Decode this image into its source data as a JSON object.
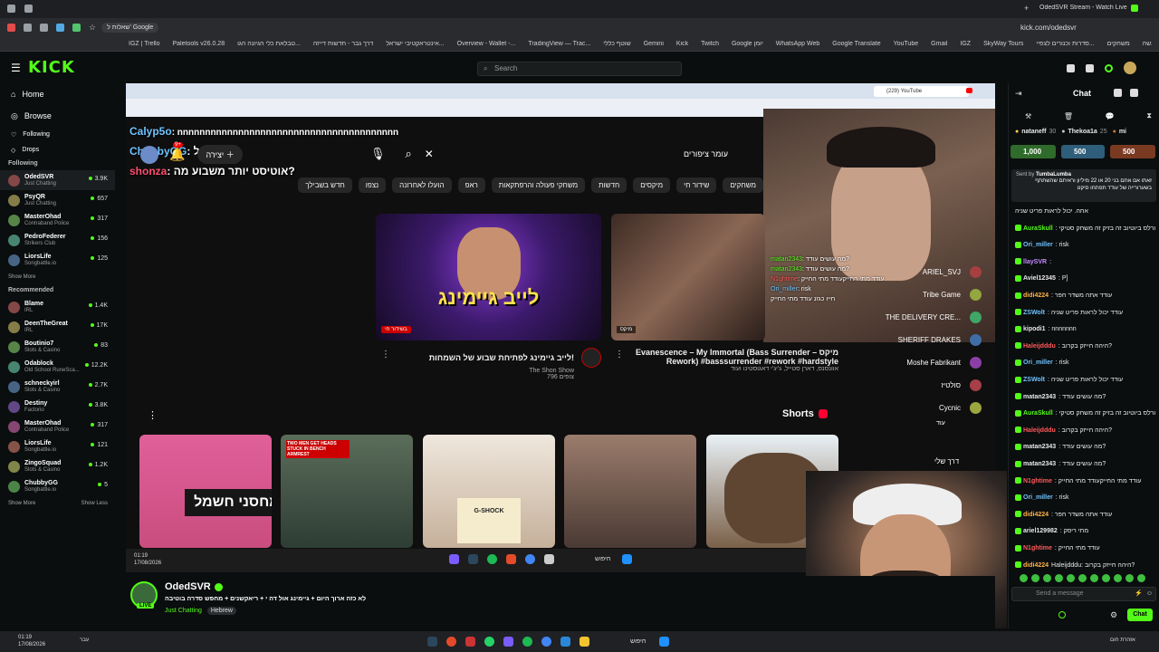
{
  "browser": {
    "tabs": [
      {
        "label": "שאלות ל' Google"
      },
      {
        "label": "OdedSVR Stream - Watch Live"
      }
    ],
    "address": "kick.com/odedsvr",
    "bookmarks": [
      "IGZ | Trello",
      "Paletools v26.0.28",
      "טבלאת כלי הגיונה הגו...",
      "דרך גבר - חדשות דייזה",
      "אינטראקטיבי ישראל...",
      "Overview - Wallet -...",
      "TradingView — Trac...",
      "שוטף כללי",
      "Gemini",
      "Kick",
      "Twitch",
      "Google יומן",
      "WhatsApp Web",
      "Google Translate",
      "YouTube",
      "Gmail",
      "IGZ",
      "SkyWay Tours",
      "סדרות וכנורים לצפיי...",
      "משחקים",
      "למעשה"
    ]
  },
  "kick": {
    "logo": "KICK",
    "search_placeholder": "Search",
    "brand_color": "#53fc18"
  },
  "sidebar": {
    "nav": [
      {
        "label": "Home",
        "icon": "home-icon"
      },
      {
        "label": "Browse",
        "icon": "compass-icon"
      },
      {
        "label": "Following",
        "icon": "heart-icon"
      },
      {
        "label": "Drops",
        "icon": "drop-icon"
      }
    ],
    "following_title": "Following",
    "following": [
      {
        "name": "OdedSVR",
        "category": "Just Chatting",
        "viewers": "3.9K"
      },
      {
        "name": "PsyQR",
        "category": "Just Chatting",
        "viewers": "657"
      },
      {
        "name": "MasterOhad",
        "category": "Contraband Police",
        "viewers": "317"
      },
      {
        "name": "PedroFederer",
        "category": "Strikers Club",
        "viewers": "156"
      },
      {
        "name": "LiorsLife",
        "category": "Songbattle.io",
        "viewers": "125"
      }
    ],
    "show_more": "Show More",
    "recommended_title": "Recommended",
    "recommended": [
      {
        "name": "Blame",
        "category": "IRL",
        "viewers": "1.4K"
      },
      {
        "name": "DeenTheGreat",
        "category": "IRL",
        "viewers": "17K"
      },
      {
        "name": "Boutinio7",
        "category": "Slots & Casino",
        "viewers": "83"
      },
      {
        "name": "Odablock",
        "category": "Old School RuneSca...",
        "viewers": "12.2K"
      },
      {
        "name": "schneckyirl",
        "category": "Slots & Casino",
        "viewers": "2.7K"
      },
      {
        "name": "Destiny",
        "category": "Factorio",
        "viewers": "3.8K"
      },
      {
        "name": "MasterOhad",
        "category": "Contraband Police",
        "viewers": "317"
      },
      {
        "name": "LiorsLife",
        "category": "Songbattle.io",
        "viewers": "121"
      },
      {
        "name": "ZingoSquad",
        "category": "Slots & Casino",
        "viewers": "1.2K"
      },
      {
        "name": "ChubbyGG",
        "category": "Songbattle.io",
        "viewers": "5"
      }
    ],
    "show_more_2": "Show More",
    "show_less": "Show Less"
  },
  "overlay_big": [
    {
      "user": "Calyp5o",
      "text": ": nnnnnnnnnnnnnnnnnnnnnnnnnnnnnnnnnnnnnnnn"
    },
    {
      "user": "ChubbyGG",
      "text": ": פאמל?"
    },
    {
      "user": "shonza",
      "text": ": אוטיסט יותר משבוע מה?"
    }
  ],
  "youtube": {
    "inner_tab": "(229) YouTube",
    "search_value": "עומר ציפורים",
    "create_label": "יצירה",
    "notif_count": "9+",
    "chips": [
      "משחקים",
      "שידור חי",
      "מיקסים",
      "חדשות",
      "משחקי פעולה והרפתקאות",
      "ראפ",
      "הועלו לאחרונה",
      "נצפו",
      "חדש בשבילך"
    ],
    "video1": {
      "thumb_text": "לייב גיימינג",
      "title": "לייב גיימינג לפתיחת שבוע של השמחות!",
      "channel": "The Shon Show",
      "meta": "796 צופים",
      "badge": "בשידור חי"
    },
    "video2": {
      "title": "Evanescence – My Immortal (Bass Surrender – מיקס Rework) #basssurrender #rework #hardstyle",
      "meta": "אוונסנס, דארן סטייל, ג'יג'י דאגוסטינו ועוד",
      "badge": "מיקס"
    },
    "shorts_title": "Shorts",
    "shorts": [
      "מחסני חשמל",
      "TWO MEN GET HEADS STUCK IN BENCH ARMREST",
      "G-SHOCK",
      "",
      ""
    ],
    "sidebar_channels": [
      "ARIEL_SVJ",
      "Tribe Game",
      "THE DELIVERY CRE...",
      "SHERIFF DRAKES",
      "Moshe Fabrikant",
      "סולטיז",
      "Cycnic"
    ],
    "sidebar_more": "עוד",
    "sidebar_browse": "דרך שלי",
    "taskbar_time": "01:19",
    "taskbar_date": "17/08/2026",
    "taskbar_search": "חיפוש"
  },
  "stream_overlay_chat": [
    {
      "user": "matan2343",
      "text": ": מה עושים עודד?"
    },
    {
      "user": "matan2343",
      "text": ": מה עושים עודד?"
    },
    {
      "user": "N1ghtime",
      "text": ": עודד מתי החייקעודד מתי החייק"
    },
    {
      "user": "Ori_miller",
      "text": ": risk"
    },
    {
      "user": "",
      "text": "חייו כגזנ עודד מתי החייק"
    }
  ],
  "stream_info": {
    "name": "OdedSVR",
    "title": "לא כזה ארוך היום + גיימינג אול דה י + ריאקשנים + מחפש סדרה בוטיבה",
    "category": "Just Chatting",
    "tag": "Hebrew"
  },
  "chat": {
    "title": "Chat",
    "top_gifters": [
      {
        "name": "nataneff",
        "count": "30"
      },
      {
        "name": "Thekoa1a",
        "count": "25"
      },
      {
        "name": "mi",
        "count": ""
      }
    ],
    "gifts": [
      {
        "amount": "1,000",
        "color": "#2f6b2a"
      },
      {
        "amount": "500",
        "color": "#2f5e7a"
      },
      {
        "amount": "500",
        "color": "#7a3a22"
      }
    ],
    "pinned_sender": "Sent by",
    "pinned_user": "TumbaLumba",
    "pinned_text": "זאתו אם אתם בני 20 או 22 מיליון וראיתם שהשתתף בשערורייה של עודד תפתחו סיקט",
    "messages": [
      {
        "user": "",
        "text": "אחה. יכול לראות פריט שניה",
        "color": "#e8e8e8"
      },
      {
        "user": "AuraSkull",
        "text": ": עודד תכתוב בגורלס ביוטיוב זה בזיק זה משחק סטיקי",
        "color": "#53fc18"
      },
      {
        "user": "Ori_miller",
        "text": ": risk",
        "color": "#6fc3ff"
      },
      {
        "user": "llaySVR",
        "text": ":",
        "color": "#c38bff"
      },
      {
        "user": "Aviel12345",
        "text": ": P]",
        "color": "#e8e8e8"
      },
      {
        "user": "didi4224",
        "text": ": עודד אתה משדר חפר",
        "color": "#ffb347"
      },
      {
        "user": "ZSWolt",
        "text": ": עודד יכול לראות פריט שניה",
        "color": "#6fc3ff"
      },
      {
        "user": "kipodi1",
        "text": ": nnnnnnn",
        "color": "#e8e8e8"
      },
      {
        "user": "Haleijdddu",
        "text": ": היהה חייזק בקרוב?",
        "color": "#ff5a5a"
      },
      {
        "user": "Ori_miller",
        "text": ": risk",
        "color": "#6fc3ff"
      },
      {
        "user": "ZSWolt",
        "text": ": עודד יכול לראות פריט שניה",
        "color": "#6fc3ff"
      },
      {
        "user": "matan2343",
        "text": ": מה עושים עודד?",
        "color": "#e8e8e8"
      },
      {
        "user": "AuraSkull",
        "text": ": עודד תכתוב בגורלס ביוטיוב זה בזיק זה משחק סטיקי",
        "color": "#53fc18"
      },
      {
        "user": "Haleijdddu",
        "text": ": היהה חייזק בקרוב?",
        "color": "#ff5a5a"
      },
      {
        "user": "matan2343",
        "text": ": מה עושים עודד?",
        "color": "#e8e8e8"
      },
      {
        "user": "matan2343",
        "text": ": מה עושים עודד?",
        "color": "#e8e8e8"
      },
      {
        "user": "N1ghtime",
        "text": ": עודד מתי החייקעודד מתי החייק",
        "color": "#ff5a5a"
      },
      {
        "user": "Ori_miller",
        "text": ": risk",
        "color": "#6fc3ff"
      },
      {
        "user": "didi4224",
        "text": ": עודד אתה משדר חפר",
        "color": "#ffb347"
      },
      {
        "user": "ariel129982",
        "text": ": מתי ריסק",
        "color": "#e8e8e8"
      },
      {
        "user": "N1ghtime",
        "text": ": עודד מתי החייק",
        "color": "#ff5a5a"
      },
      {
        "user": "didi4224",
        "text": "Haleijdddu: היהה חייזק בקרוב?",
        "color": "#ffb347"
      }
    ],
    "input_placeholder": "Send a message",
    "send_label": "Chat"
  },
  "os_taskbar": {
    "time": "01:19",
    "date": "17/08/2026",
    "search": "חיפוש",
    "weather": "עבר",
    "lang_note": "אזהרת חום"
  }
}
